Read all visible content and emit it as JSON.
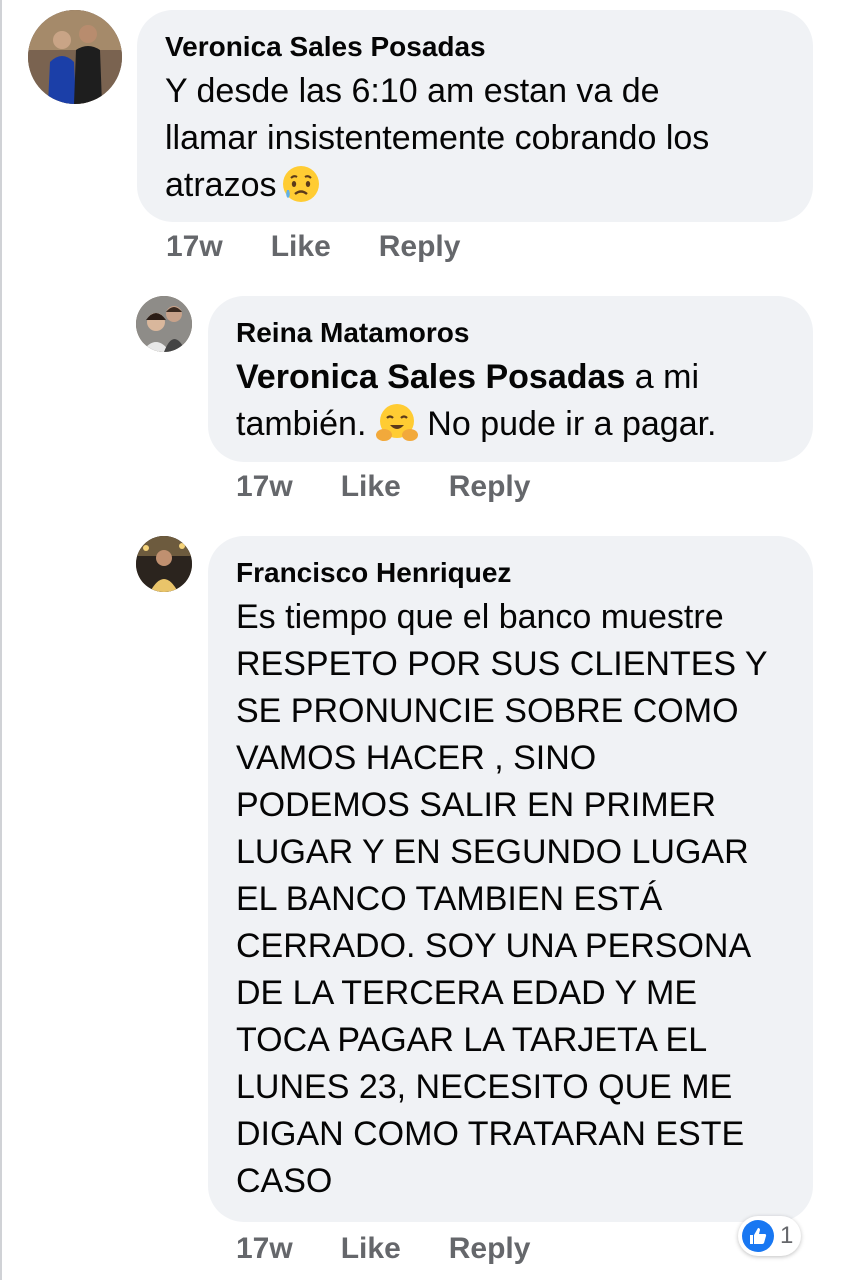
{
  "comments": [
    {
      "author": "Veronica Sales Posadas",
      "lines": [
        "Y desde las 6:10 am estan va de",
        "llamar insistentemente cobrando los",
        "atrazos"
      ],
      "emoji": "sad-relieved-emoji",
      "time": "17w",
      "like": "Like",
      "reply": "Reply"
    },
    {
      "author": "Reina Matamoros",
      "mention": "Veronica Sales Posadas",
      "line1_rest": " a mi",
      "line2_pre": "también. ",
      "line2_post": " No pude ir a pagar.",
      "emoji": "hugging-face-emoji",
      "time": "17w",
      "like": "Like",
      "reply": "Reply"
    },
    {
      "author": "Francisco Henriquez",
      "lines": [
        "Es tiempo que el banco muestre",
        "RESPETO POR SUS CLIENTES Y",
        "SE PRONUNCIE SOBRE COMO",
        "VAMOS HACER , SINO",
        "PODEMOS SALIR EN PRIMER",
        "LUGAR Y EN SEGUNDO LUGAR",
        "EL BANCO TAMBIEN ESTÁ",
        "CERRADO. SOY UNA PERSONA",
        "DE LA TERCERA EDAD Y ME",
        "TOCA PAGAR LA TARJETA EL",
        "LUNES 23, NECESITO QUE ME",
        "DIGAN COMO TRATARAN ESTE",
        "CASO"
      ],
      "time": "17w",
      "like": "Like",
      "reply": "Reply",
      "reaction_icon": "thumbs-up-icon",
      "reaction_count": "1"
    }
  ],
  "colors": {
    "bubble": "#f0f2f5",
    "meta": "#65676b",
    "like_blue": "#1877f2"
  }
}
